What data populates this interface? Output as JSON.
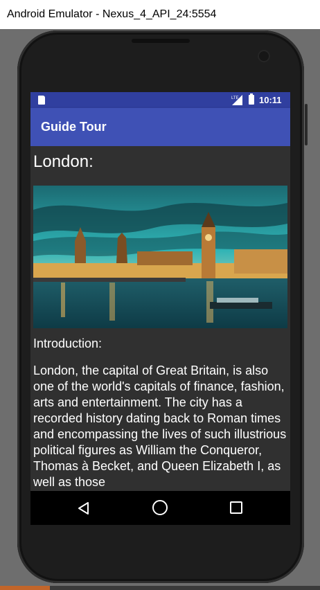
{
  "window": {
    "title": "Android Emulator - Nexus_4_API_24:5554"
  },
  "status_bar": {
    "time": "10:11",
    "signal_label": "LTE"
  },
  "app_bar": {
    "title": "Guide Tour"
  },
  "content": {
    "city_heading": "London:",
    "image_description": "Houses of Parliament and Big Ben at dusk",
    "intro_label": "Introduction:",
    "intro_text": "London, the capital of Great Britain, is also one of the world's capitals of finance, fashion, arts and entertainment. The city has a recorded history dating back to Roman times and encompassing the lives of such illustrious political figures as William the Conqueror, Thomas à Becket, and Queen Elizabeth I, as well as those"
  },
  "nav_bar": {
    "back": "back",
    "home": "home",
    "recents": "recents"
  },
  "colors": {
    "status_bar": "#303f9f",
    "app_bar": "#3f51b5",
    "screen_background": "#303030"
  }
}
